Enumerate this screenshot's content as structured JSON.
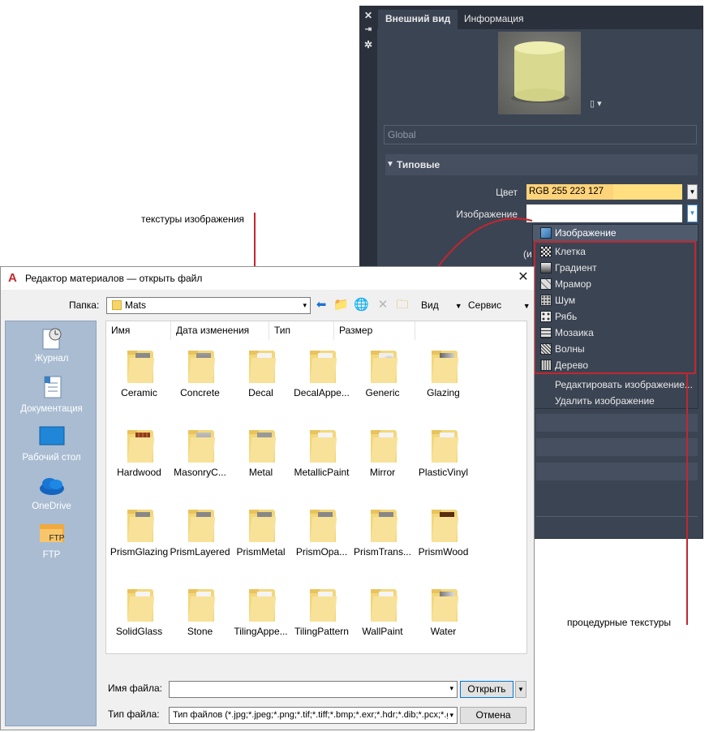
{
  "materials_panel": {
    "tabs": [
      "Внешний вид",
      "Информация"
    ],
    "global_placeholder": "Global",
    "section_title": "Типовые",
    "color_label": "Цвет",
    "color_value": "RGB 255 223 127",
    "image_label": "Изображение",
    "partial_text": "(из",
    "colors": {
      "panel_bg": "#3b4453",
      "color_swatch": "#ffdf7f",
      "highlight": "#c4262e"
    },
    "strip_icons": [
      "close-icon",
      "pin-icon",
      "settings-icon"
    ]
  },
  "dropdown": {
    "header": "Изображение",
    "procedural": [
      "Клетка",
      "Градиент",
      "Мрамор",
      "Шум",
      "Рябь",
      "Мозаика",
      "Волны",
      "Дерево"
    ],
    "actions": [
      "Редактировать изображение...",
      "Удалить изображение"
    ]
  },
  "annotations": {
    "image_textures": "текстуры изображения",
    "procedural_textures": "процедурные текстуры"
  },
  "dialog": {
    "title": "Редактор материалов — открыть файл",
    "folder_label": "Папка:",
    "folder_value": "Mats",
    "view_label": "Вид",
    "tools_label": "Сервис",
    "places": [
      "Журнал",
      "Документация",
      "Рабочий стол",
      "OneDrive",
      "FTP"
    ],
    "ftp_badge": "FTP",
    "columns": [
      "Имя",
      "Дата изменения",
      "Тип",
      "Размер"
    ],
    "files": [
      "Ceramic",
      "Concrete",
      "Decal",
      "DecalAppe...",
      "Generic",
      "Glazing",
      "Hardwood",
      "MasonryC...",
      "Metal",
      "MetallicPaint",
      "Mirror",
      "PlasticVinyl",
      "PrismGlazing",
      "PrismLayered",
      "PrismMetal",
      "PrismOpa...",
      "PrismTrans...",
      "PrismWood",
      "SolidGlass",
      "Stone",
      "TilingAppe...",
      "TilingPattern",
      "WallPaint",
      "Water"
    ],
    "filename_label": "Имя файла:",
    "filetype_label": "Тип файла:",
    "filetype_value": "Тип файлов  (*.jpg;*.jpeg;*.png;*.tif;*.tiff;*.bmp;*.exr;*.hdr;*.dib;*.pcx;*.g",
    "open_label": "Открыть",
    "cancel_label": "Отмена"
  }
}
